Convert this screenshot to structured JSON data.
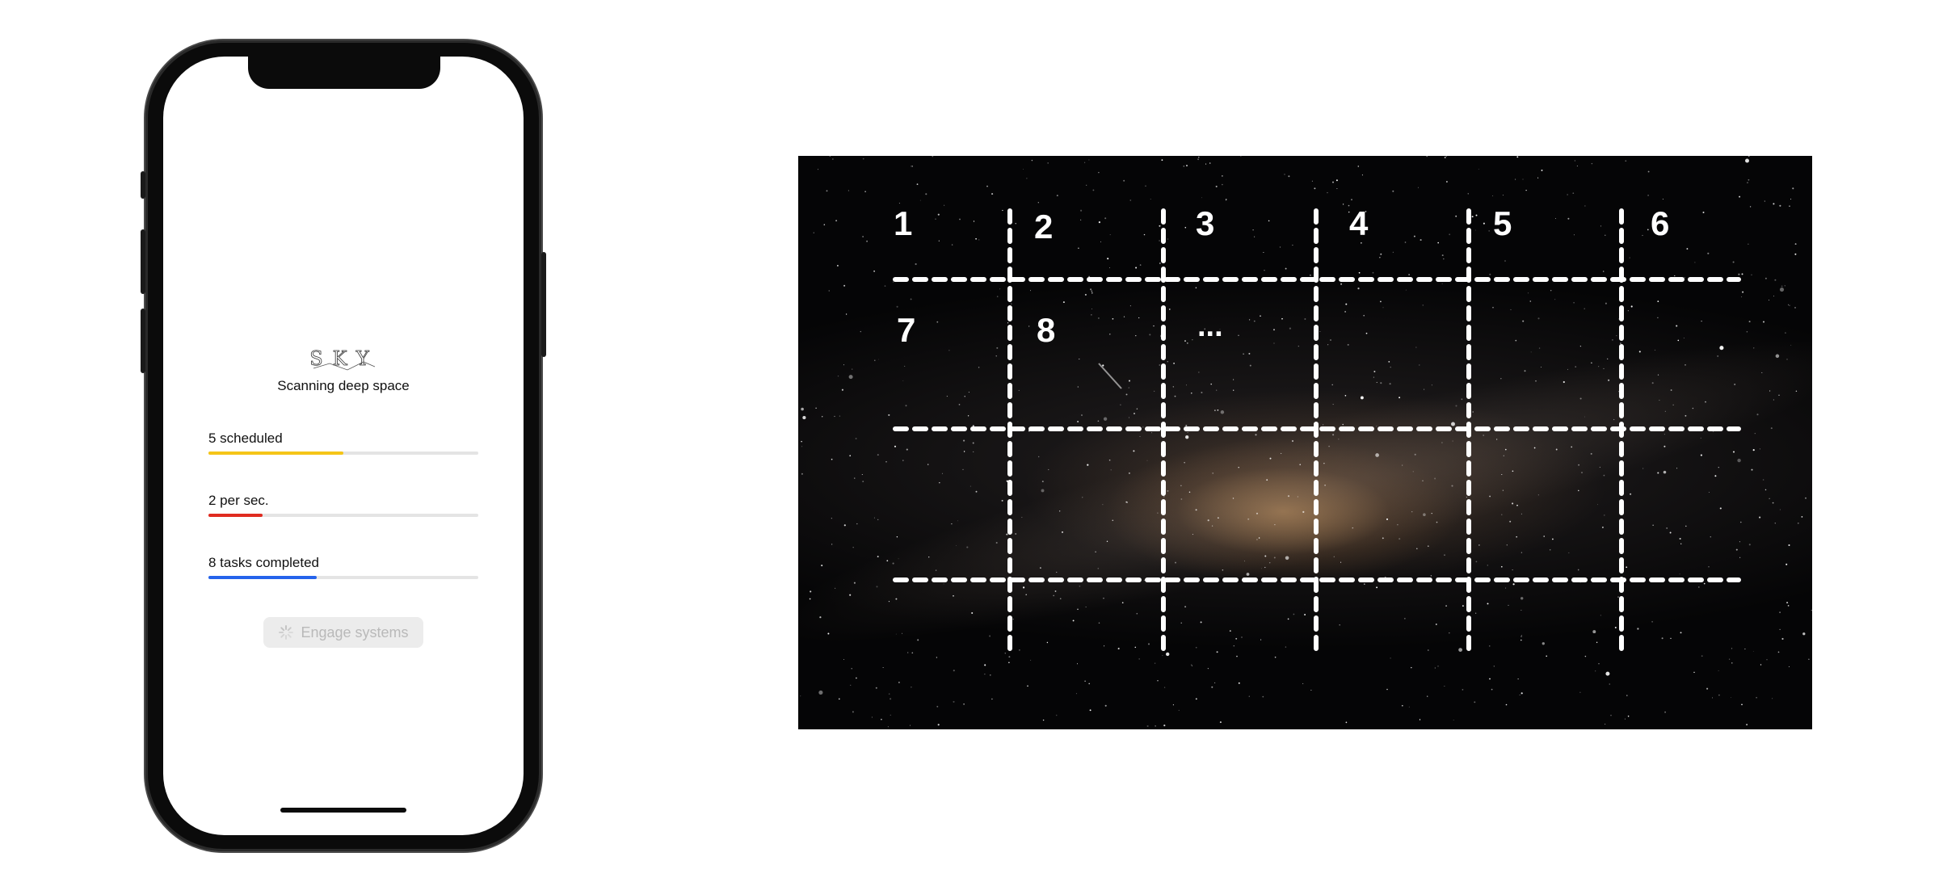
{
  "app": {
    "logo_text": "SKY",
    "subtitle": "Scanning deep space"
  },
  "metrics": [
    {
      "label": "5 scheduled",
      "progress": 0.5,
      "color": "#f5c518"
    },
    {
      "label": "2 per sec.",
      "progress": 0.2,
      "color": "#e02b20"
    },
    {
      "label": "8 tasks completed",
      "progress": 0.4,
      "color": "#2563eb"
    }
  ],
  "engage_button": {
    "label": "Engage systems",
    "icon": "spinner-icon",
    "enabled": false
  },
  "grid": {
    "cells": [
      "1",
      "2",
      "3",
      "4",
      "5",
      "6",
      "7",
      "8",
      "..."
    ]
  }
}
